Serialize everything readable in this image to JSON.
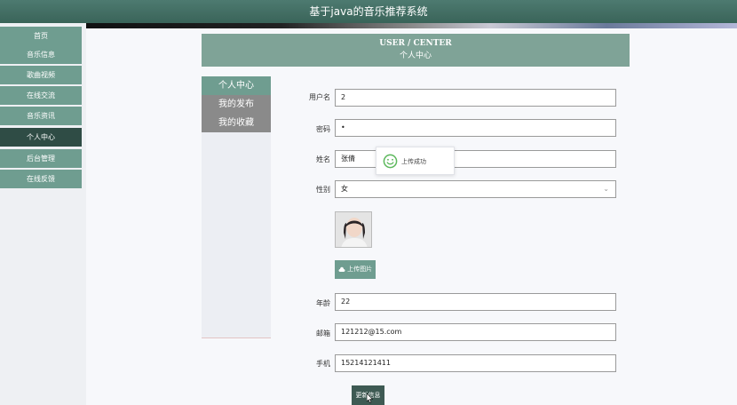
{
  "app": {
    "title": "基于java的音乐推荐系统"
  },
  "sidebar": {
    "items": [
      {
        "label": "首页",
        "active": false
      },
      {
        "label": "音乐信息",
        "active": false
      },
      {
        "label": "歌曲视频",
        "active": false
      },
      {
        "label": "在线交流",
        "active": false
      },
      {
        "label": "音乐资讯",
        "active": false
      },
      {
        "label": "个人中心",
        "active": true
      },
      {
        "label": "后台管理",
        "active": false
      },
      {
        "label": "在线反馈",
        "active": false
      }
    ]
  },
  "center_header": {
    "en": "USER / CENTER",
    "cn": "个人中心"
  },
  "subnav": {
    "items": [
      {
        "label": "个人中心",
        "active": true
      },
      {
        "label": "我的发布",
        "active": false
      },
      {
        "label": "我的收藏",
        "active": false
      }
    ]
  },
  "form": {
    "username": {
      "label": "用户名",
      "value": "2"
    },
    "password": {
      "label": "密码",
      "value": "•"
    },
    "name": {
      "label": "姓名",
      "value": "张倩"
    },
    "gender": {
      "label": "性别",
      "value": "女"
    },
    "upload_label": "上传图片",
    "age": {
      "label": "年龄",
      "value": "22"
    },
    "email": {
      "label": "邮箱",
      "value": "121212@15.com"
    },
    "phone": {
      "label": "手机",
      "value": "15214121411"
    },
    "update_label": "更新信息"
  },
  "toast": {
    "message": "上传成功",
    "icon": "smile-icon"
  },
  "colors": {
    "accent": "#6f9d90",
    "active_nav": "#2f4c45",
    "header": "#7fa397"
  }
}
